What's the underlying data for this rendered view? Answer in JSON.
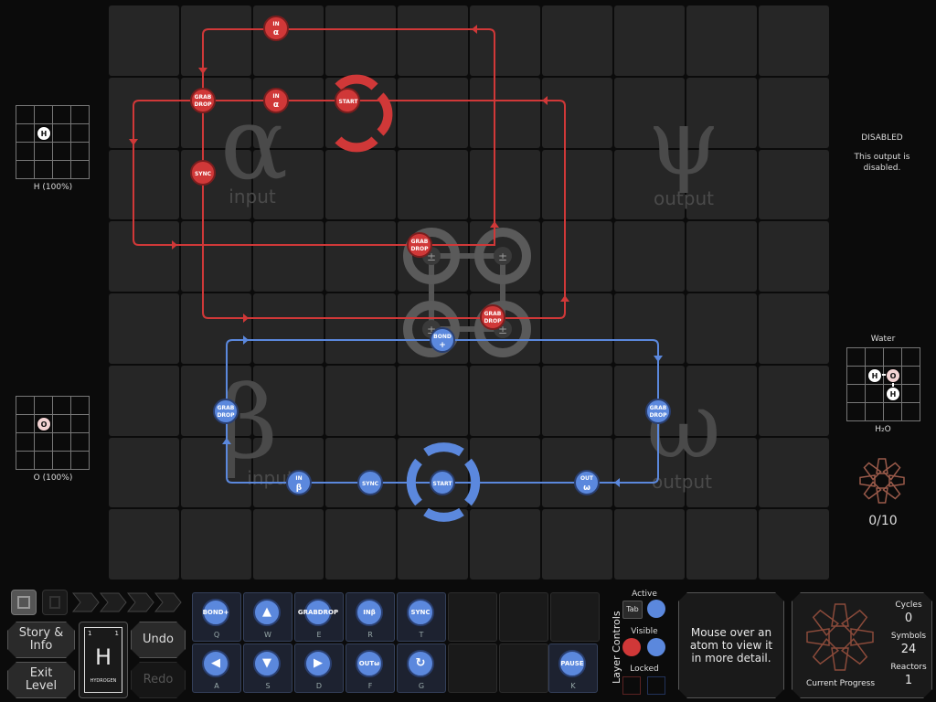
{
  "colors": {
    "red": "#d03838",
    "blue": "#5b88dd",
    "cell": "#262626",
    "bg": "#0b0b0b"
  },
  "regions": {
    "alpha": {
      "glyph": "α",
      "label": "input"
    },
    "beta": {
      "glyph": "β",
      "label": "input"
    },
    "psi": {
      "glyph": "ψ",
      "label": "output"
    },
    "omega": {
      "glyph": "ω",
      "label": "output"
    }
  },
  "red_symbols": {
    "in_top": {
      "line1": "IN",
      "line2": "α"
    },
    "in_mid": {
      "line1": "IN",
      "line2": "α"
    },
    "grab1": {
      "line1": "GRAB",
      "line2": "DROP"
    },
    "sync": {
      "line1": "SYNC"
    },
    "start": {
      "line1": "START"
    },
    "grab2": {
      "line1": "GRAB",
      "line2": "DROP"
    },
    "grab3": {
      "line1": "GRAB",
      "line2": "DROP"
    }
  },
  "blue_symbols": {
    "bond": {
      "line1": "BOND",
      "line2": "+"
    },
    "grab_left": {
      "line1": "GRAB",
      "line2": "DROP"
    },
    "in_beta": {
      "line1": "IN",
      "line2": "β"
    },
    "sync": {
      "line1": "SYNC"
    },
    "start": {
      "line1": "START"
    },
    "out": {
      "line1": "OUT",
      "line2": "ω"
    },
    "grab_right": {
      "line1": "GRAB",
      "line2": "DROP"
    }
  },
  "bonders": {
    "symbol": "±"
  },
  "left_panel": {
    "alpha_input": {
      "atom": "H",
      "caption": "H (100%)"
    },
    "beta_input": {
      "atom": "O",
      "caption": "O (100%)"
    }
  },
  "right_panel": {
    "psi_status": {
      "title": "DISABLED",
      "text": "This output is disabled."
    },
    "omega_output": {
      "title": "Water",
      "atoms": [
        "H",
        "O",
        "H"
      ],
      "formula": "H₂O"
    },
    "progress": "0/10"
  },
  "toolbar": {
    "story_label": "Story & Info",
    "exit_label": "Exit Level",
    "undo_label": "Undo",
    "redo_label": "Redo",
    "element": {
      "symbol": "H",
      "name": "HYDROGEN",
      "number": "1",
      "mass": "1"
    },
    "palette_top": [
      {
        "line1": "BOND",
        "line2": "+",
        "key": "Q"
      },
      {
        "line1": "▲",
        "line2": "",
        "key": "W"
      },
      {
        "line1": "GRAB",
        "line2": "DROP",
        "key": "E"
      },
      {
        "line1": "IN",
        "line2": "β",
        "key": "R"
      },
      {
        "line1": "SYNC",
        "line2": "",
        "key": "T"
      }
    ],
    "palette_bottom": [
      {
        "line1": "◀",
        "line2": "",
        "key": "A"
      },
      {
        "line1": "▼",
        "line2": "",
        "key": "S"
      },
      {
        "line1": "▶",
        "line2": "",
        "key": "D"
      },
      {
        "line1": "OUT",
        "line2": "ω",
        "key": "F"
      },
      {
        "line1": "↻",
        "line2": "",
        "key": "G"
      }
    ],
    "pause": {
      "label": "PAUSE",
      "key": "K"
    }
  },
  "layer_controls": {
    "title": "Layer Controls",
    "active_label": "Active",
    "tab_label": "Tab",
    "visible_label": "Visible",
    "locked_label": "Locked"
  },
  "info_box": "Mouse over an atom to view it in more detail.",
  "stats": {
    "cycles_label": "Cycles",
    "cycles_value": "0",
    "symbols_label": "Symbols",
    "symbols_value": "24",
    "reactors_label": "Reactors",
    "reactors_value": "1",
    "progress_label": "Current Progress"
  }
}
